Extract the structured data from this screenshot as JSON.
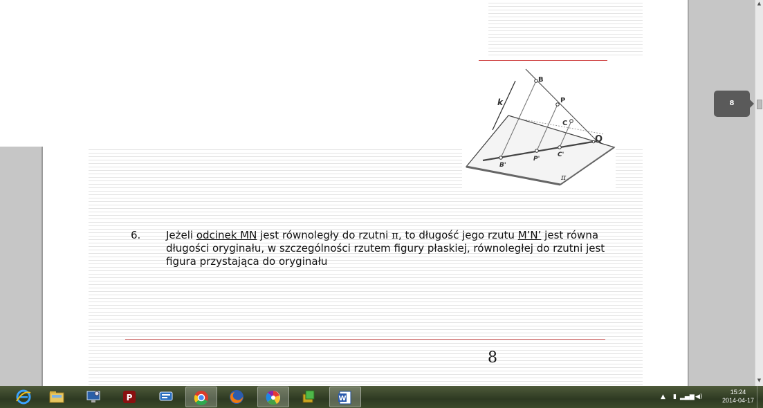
{
  "document": {
    "item_number": "6.",
    "paragraph": {
      "part1": "Jeżeli ",
      "underlined1": "odcinek MN",
      "part2": " jest równoległy do rzutni ",
      "pi": "π",
      "part3": ", to długość jego rzutu ",
      "underlined2": "M’N’",
      "part4": " jest równa długości oryginału, w szczególności rzutem figury płaskiej, równoległej do rzutni  jest figura przystająca do oryginału"
    },
    "page_number": "8"
  },
  "figure": {
    "labels": {
      "k": "k",
      "B": "B",
      "P": "P",
      "C": "C",
      "Q": "Q",
      "B_prime": "B'",
      "P_prime": "P'",
      "C_prime": "C'",
      "pi": "π"
    }
  },
  "viewer": {
    "page_indicator": "8"
  },
  "taskbar": {
    "apps": [
      {
        "name": "internet-explorer",
        "icon": "ie-icon"
      },
      {
        "name": "file-explorer",
        "icon": "folder-icon"
      },
      {
        "name": "remote-desktop",
        "icon": "monitor-icon"
      },
      {
        "name": "acrobat",
        "icon": "acrobat-icon"
      },
      {
        "name": "communicator",
        "icon": "chat-icon"
      },
      {
        "name": "chrome",
        "icon": "chrome-icon",
        "active": true
      },
      {
        "name": "firefox",
        "icon": "firefox-icon"
      },
      {
        "name": "picasa",
        "icon": "picasa-icon"
      },
      {
        "name": "app-green",
        "icon": "app-icon"
      },
      {
        "name": "word",
        "icon": "word-icon"
      }
    ],
    "clock_time": "15:24",
    "clock_date": "2014-04-17"
  }
}
